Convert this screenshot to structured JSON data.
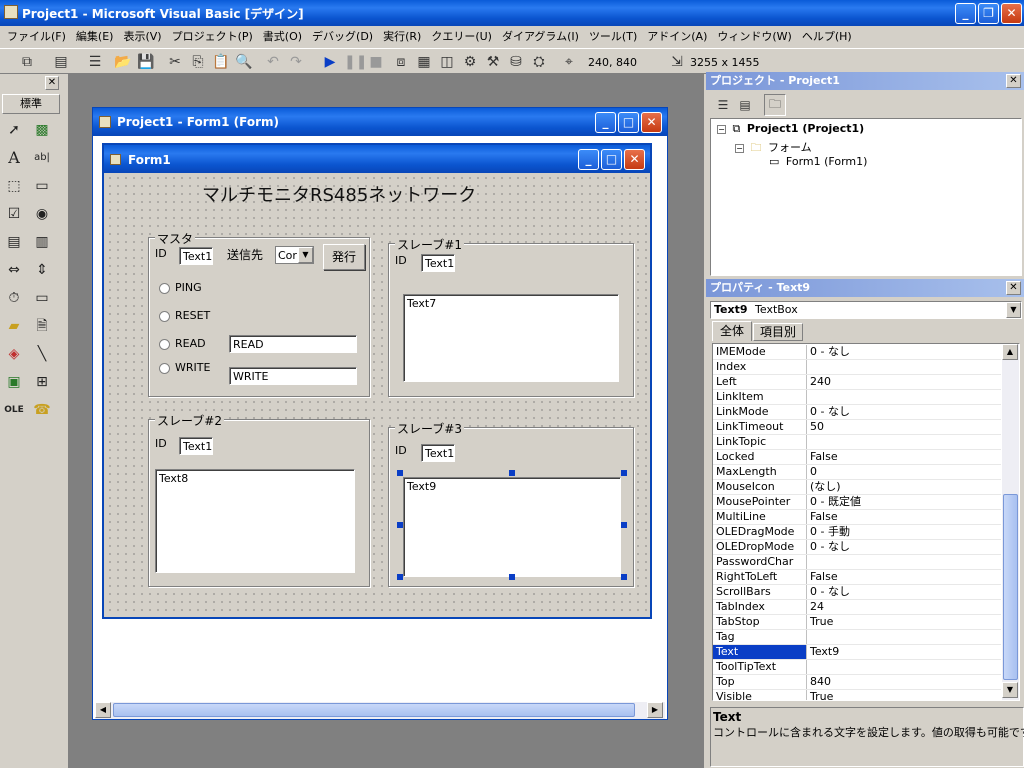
{
  "app": {
    "title": "Project1 - Microsoft Visual Basic [デザイン]"
  },
  "menu": [
    "ファイル(F)",
    "編集(E)",
    "表示(V)",
    "プロジェクト(P)",
    "書式(O)",
    "デバッグ(D)",
    "実行(R)",
    "クエリー(U)",
    "ダイアグラム(I)",
    "ツール(T)",
    "アドイン(A)",
    "ウィンドウ(W)",
    "ヘルプ(H)"
  ],
  "toolbar": {
    "position": "240, 840",
    "size": "3255 x 1455"
  },
  "toolbox": {
    "tab_label": "標準"
  },
  "mdi_form": {
    "title": "Project1 - Form1 (Form)"
  },
  "form1": {
    "title": "Form1",
    "heading": "マルチモニタRS485ネットワーク",
    "master": {
      "caption": "マスタ",
      "id_label": "ID",
      "id_value": "Text1",
      "dest_label": "送信先",
      "dest_combo": "Cor",
      "send_button": "発行",
      "options": [
        "PING",
        "RESET",
        "READ",
        "WRITE"
      ],
      "read_value": "READ",
      "write_value": "WRITE"
    },
    "slave1": {
      "caption": "スレーブ#1",
      "id_label": "ID",
      "id_value": "Text1",
      "text_value": "Text7"
    },
    "slave2": {
      "caption": "スレーブ#2",
      "id_label": "ID",
      "id_value": "Text1",
      "text_value": "Text8"
    },
    "slave3": {
      "caption": "スレーブ#3",
      "id_label": "ID",
      "id_value": "Text1",
      "text_value": "Text9"
    }
  },
  "project": {
    "title": "プロジェクト - Project1",
    "root": "Project1 (Project1)",
    "folder": "フォーム",
    "item": "Form1 (Form1)"
  },
  "properties": {
    "title": "プロパティ - Text9",
    "object_name": "Text9",
    "object_type": "TextBox",
    "tabs": [
      "全体",
      "項目別"
    ],
    "rows": [
      {
        "name": "IMEMode",
        "value": "0 - なし"
      },
      {
        "name": "Index",
        "value": ""
      },
      {
        "name": "Left",
        "value": "240"
      },
      {
        "name": "LinkItem",
        "value": ""
      },
      {
        "name": "LinkMode",
        "value": "0 - なし"
      },
      {
        "name": "LinkTimeout",
        "value": "50"
      },
      {
        "name": "LinkTopic",
        "value": ""
      },
      {
        "name": "Locked",
        "value": "False"
      },
      {
        "name": "MaxLength",
        "value": "0"
      },
      {
        "name": "MouseIcon",
        "value": "(なし)"
      },
      {
        "name": "MousePointer",
        "value": "0 - 既定値"
      },
      {
        "name": "MultiLine",
        "value": "False"
      },
      {
        "name": "OLEDragMode",
        "value": "0 - 手動"
      },
      {
        "name": "OLEDropMode",
        "value": "0 - なし"
      },
      {
        "name": "PasswordChar",
        "value": ""
      },
      {
        "name": "RightToLeft",
        "value": "False"
      },
      {
        "name": "ScrollBars",
        "value": "0 - なし"
      },
      {
        "name": "TabIndex",
        "value": "24"
      },
      {
        "name": "TabStop",
        "value": "True"
      },
      {
        "name": "Tag",
        "value": ""
      },
      {
        "name": "Text",
        "value": "Text9",
        "selected": true
      },
      {
        "name": "ToolTipText",
        "value": ""
      },
      {
        "name": "Top",
        "value": "840"
      },
      {
        "name": "Visible",
        "value": "True"
      }
    ],
    "desc_title": "Text",
    "desc_text": "コントロールに含まれる文字を設定します。値の取得も可能です。"
  }
}
